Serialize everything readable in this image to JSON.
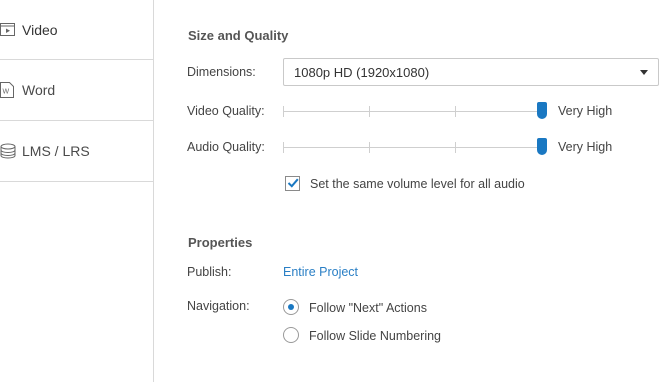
{
  "sidebar": {
    "items": [
      {
        "label": "Video",
        "icon": "video-icon",
        "active": true
      },
      {
        "label": "Word",
        "icon": "word-icon",
        "active": false
      },
      {
        "label": "LMS / LRS",
        "icon": "database-icon",
        "active": false
      }
    ]
  },
  "size_quality": {
    "title": "Size and Quality",
    "dimensions_label": "Dimensions:",
    "dimensions_value": "1080p HD (1920x1080)",
    "video_quality_label": "Video Quality:",
    "video_quality_value": "Very High",
    "video_quality_level": 1.0,
    "audio_quality_label": "Audio Quality:",
    "audio_quality_value": "Very High",
    "audio_quality_level": 1.0,
    "same_volume_label": "Set the same volume level for all audio",
    "same_volume_checked": true
  },
  "properties": {
    "title": "Properties",
    "publish_label": "Publish:",
    "publish_value": "Entire Project",
    "navigation_label": "Navigation:",
    "navigation_options": [
      {
        "label": "Follow \"Next\" Actions",
        "selected": true
      },
      {
        "label": "Follow Slide Numbering",
        "selected": false
      }
    ]
  },
  "colors": {
    "accent": "#1a78c2",
    "link": "#2a7fc5"
  }
}
